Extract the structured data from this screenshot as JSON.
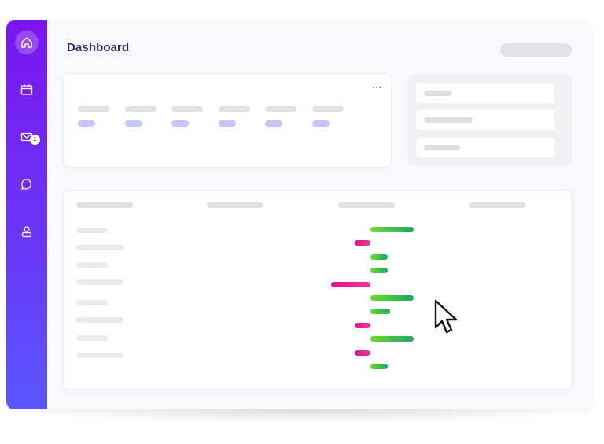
{
  "header": {
    "title": "Dashboard"
  },
  "sidebar": {
    "items": [
      {
        "icon": "home-icon",
        "active": true
      },
      {
        "icon": "calendar-icon",
        "active": false
      },
      {
        "icon": "mail-icon",
        "active": false,
        "badge": "1"
      },
      {
        "icon": "chat-icon",
        "active": false
      },
      {
        "icon": "user-icon",
        "active": false
      }
    ]
  },
  "colors": {
    "sidebar_top": "#7a16f0",
    "sidebar_bottom": "#5a56ff",
    "title": "#3c2a6e",
    "positive_bar": "#2fbf52",
    "negative_bar": "#e3108f",
    "stat_value": "#c3c6ff"
  },
  "table": {
    "bars": [
      {
        "value": 0.55,
        "sign": "positive"
      },
      {
        "value": 0.2,
        "sign": "negative"
      },
      {
        "value": 0.22,
        "sign": "positive"
      },
      {
        "value": 0.22,
        "sign": "positive"
      },
      {
        "value": 0.5,
        "sign": "negative"
      },
      {
        "value": 0.55,
        "sign": "positive"
      },
      {
        "value": 0.25,
        "sign": "positive"
      },
      {
        "value": 0.2,
        "sign": "negative"
      },
      {
        "value": 0.55,
        "sign": "positive"
      },
      {
        "value": 0.2,
        "sign": "negative"
      },
      {
        "value": 0.22,
        "sign": "positive"
      }
    ]
  }
}
